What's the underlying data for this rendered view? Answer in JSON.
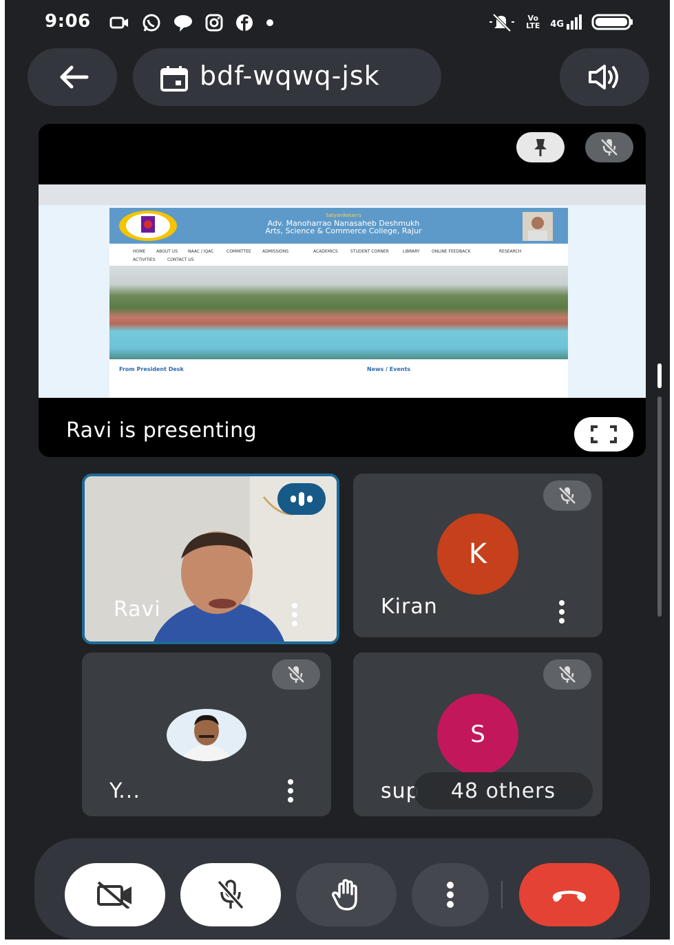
{
  "status_bar": {
    "time": "9:06",
    "left_icons": [
      "video-icon",
      "whatsapp-icon",
      "chat-bubble-icon",
      "instagram-icon",
      "facebook-icon",
      "dot"
    ],
    "right_icons": [
      "mute-icon",
      "volte-icon",
      "4g-signal-icon",
      "battery-icon"
    ],
    "volte_label": "Vo LTE",
    "network_label": "4G"
  },
  "header": {
    "meeting_code": "bdf-wqwq-jsk"
  },
  "presentation": {
    "caption": "Ravi is presenting",
    "shared_site": {
      "tagline": "Satyaniketan's",
      "college_name": "Adv. Manoharrao Nanasaheb Deshmukh",
      "college_name_2": "Arts, Science & Commerce College, Rajur",
      "nav": [
        "HOME",
        "ABOUT US",
        "NAAC / IQAC",
        "COMMITTEE",
        "ADMISSIONS",
        "ACADEMICS",
        "STUDENT CORNER",
        "LIBRARY",
        "ONLINE FEEDBACK",
        "RESEARCH",
        "ACTIVITIES",
        "CONTACT US"
      ],
      "section_left": "From President Desk",
      "section_right": "News / Events"
    }
  },
  "participants": [
    {
      "name": "Ravi",
      "state": "speaking"
    },
    {
      "name": "Kiran",
      "initial": "K",
      "avatar_color": "#c5401b",
      "state": "muted"
    },
    {
      "name": "Y...",
      "state": "muted"
    },
    {
      "name": "sup",
      "initial": "S",
      "avatar_color": "#c2185b",
      "state": "muted",
      "overlay": "48 others"
    }
  ],
  "controls": [
    "camera-off",
    "mic-off",
    "raise-hand",
    "more-options",
    "end-call"
  ],
  "colors": {
    "background": "#1f2125",
    "pill": "#33363c",
    "end_call": "#e34234",
    "speaking_border": "#1e6a97"
  }
}
